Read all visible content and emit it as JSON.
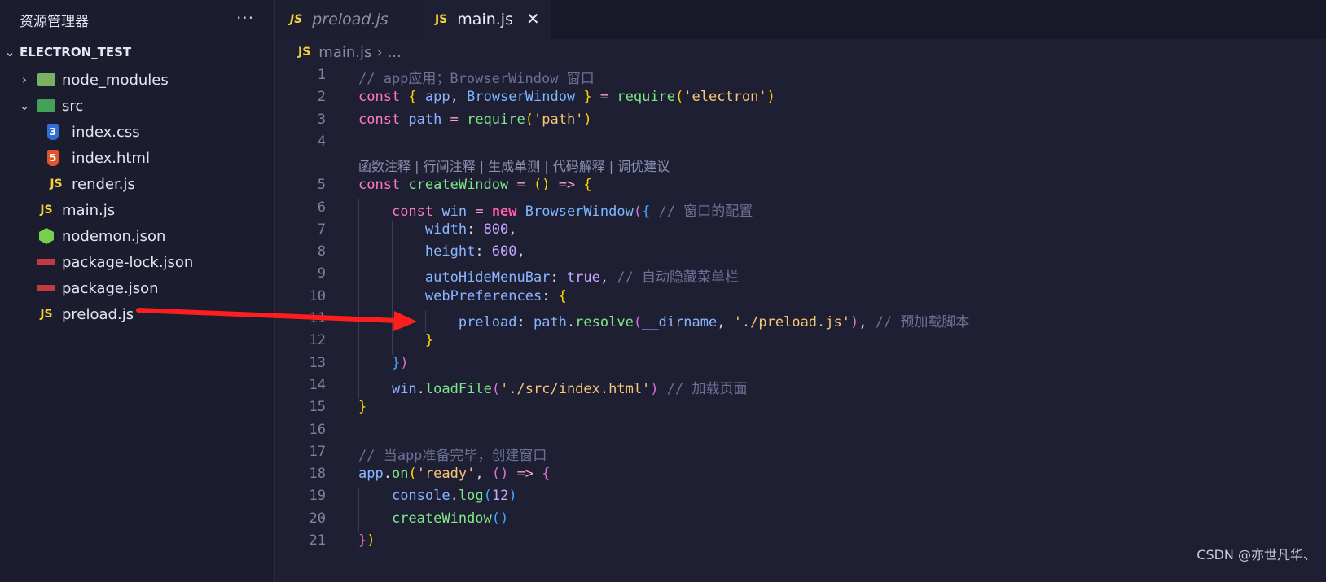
{
  "sidebar": {
    "title": "资源管理器",
    "more": "···",
    "project": "ELECTRON_TEST",
    "items": [
      {
        "label": "node_modules",
        "icon": "folder-icon",
        "chevron": "›"
      },
      {
        "label": "src",
        "icon": "folder-src-icon",
        "chevron": "⌄"
      },
      {
        "label": "index.css",
        "icon": "css-icon",
        "icon_text": "3"
      },
      {
        "label": "index.html",
        "icon": "html-icon",
        "icon_text": "5"
      },
      {
        "label": "render.js",
        "icon": "js-icon",
        "icon_text": "JS"
      },
      {
        "label": "main.js",
        "icon": "js-icon",
        "icon_text": "JS"
      },
      {
        "label": "nodemon.json",
        "icon": "nodemon-icon"
      },
      {
        "label": "package-lock.json",
        "icon": "npm-icon"
      },
      {
        "label": "package.json",
        "icon": "npm-icon"
      },
      {
        "label": "preload.js",
        "icon": "js-icon",
        "icon_text": "JS"
      }
    ]
  },
  "tabs": [
    {
      "label": "preload.js",
      "icon_text": "JS",
      "active": false
    },
    {
      "label": "main.js",
      "icon_text": "JS",
      "active": true,
      "close": "✕"
    }
  ],
  "breadcrumb": {
    "icon_text": "JS",
    "file": "main.js",
    "sep": "›",
    "rest": "..."
  },
  "editor": {
    "code_lens": "函数注释 | 行间注释 | 生成单测 | 代码解释 | 调优建议",
    "lines": [
      {
        "n": "1",
        "tokens": [
          [
            "cm",
            "// app应用；BrowserWindow 窗口"
          ]
        ]
      },
      {
        "n": "2",
        "tokens": [
          [
            "kw",
            "const "
          ],
          [
            "p1",
            "{ "
          ],
          [
            "vr",
            "app"
          ],
          [
            "pl",
            ", "
          ],
          [
            "cls",
            "BrowserWindow"
          ],
          [
            "p1",
            " }"
          ],
          [
            "op",
            " = "
          ],
          [
            "fn",
            "require"
          ],
          [
            "p1",
            "("
          ],
          [
            "st",
            "'electron'"
          ],
          [
            "p1",
            ")"
          ]
        ]
      },
      {
        "n": "3",
        "tokens": [
          [
            "kw",
            "const "
          ],
          [
            "vr",
            "path"
          ],
          [
            "op",
            " = "
          ],
          [
            "fn",
            "require"
          ],
          [
            "p1",
            "("
          ],
          [
            "st",
            "'path'"
          ],
          [
            "p1",
            ")"
          ]
        ]
      },
      {
        "n": "4",
        "tokens": []
      },
      {
        "n": "5",
        "tokens": [
          [
            "kw",
            "const "
          ],
          [
            "fn",
            "createWindow"
          ],
          [
            "op",
            " = "
          ],
          [
            "p1",
            "()"
          ],
          [
            "op",
            " => "
          ],
          [
            "p1",
            "{"
          ]
        ]
      },
      {
        "n": "6",
        "tokens": [
          [
            "pl",
            "    "
          ],
          [
            "kw",
            "const "
          ],
          [
            "vr",
            "win"
          ],
          [
            "op",
            " = "
          ],
          [
            "kw2",
            "new "
          ],
          [
            "cls",
            "BrowserWindow"
          ],
          [
            "p2",
            "("
          ],
          [
            "p3",
            "{"
          ],
          [
            "cm",
            " // 窗口的配置"
          ]
        ]
      },
      {
        "n": "7",
        "tokens": [
          [
            "pl",
            "        "
          ],
          [
            "pr",
            "width"
          ],
          [
            "pl",
            ": "
          ],
          [
            "nm",
            "800"
          ],
          [
            "pl",
            ","
          ]
        ]
      },
      {
        "n": "8",
        "tokens": [
          [
            "pl",
            "        "
          ],
          [
            "pr",
            "height"
          ],
          [
            "pl",
            ": "
          ],
          [
            "nm",
            "600"
          ],
          [
            "pl",
            ","
          ]
        ]
      },
      {
        "n": "9",
        "tokens": [
          [
            "pl",
            "        "
          ],
          [
            "pr",
            "autoHideMenuBar"
          ],
          [
            "pl",
            ": "
          ],
          [
            "nm",
            "true"
          ],
          [
            "pl",
            ", "
          ],
          [
            "cm",
            "// 自动隐藏菜单栏"
          ]
        ]
      },
      {
        "n": "10",
        "tokens": [
          [
            "pl",
            "        "
          ],
          [
            "pr",
            "webPreferences"
          ],
          [
            "pl",
            ": "
          ],
          [
            "p1",
            "{"
          ]
        ]
      },
      {
        "n": "11",
        "tokens": [
          [
            "pl",
            "            "
          ],
          [
            "pr",
            "preload"
          ],
          [
            "pl",
            ": "
          ],
          [
            "vr",
            "path"
          ],
          [
            "pl",
            "."
          ],
          [
            "fn",
            "resolve"
          ],
          [
            "p2",
            "("
          ],
          [
            "vr",
            "__dirname"
          ],
          [
            "pl",
            ", "
          ],
          [
            "st",
            "'./preload.js'"
          ],
          [
            "p2",
            ")"
          ],
          [
            "pl",
            ", "
          ],
          [
            "cm",
            "// 预加载脚本"
          ]
        ]
      },
      {
        "n": "12",
        "tokens": [
          [
            "pl",
            "        "
          ],
          [
            "p1",
            "}"
          ]
        ]
      },
      {
        "n": "13",
        "tokens": [
          [
            "pl",
            "    "
          ],
          [
            "p3",
            "}"
          ],
          [
            "p2",
            ")"
          ]
        ]
      },
      {
        "n": "14",
        "tokens": [
          [
            "pl",
            "    "
          ],
          [
            "vr",
            "win"
          ],
          [
            "pl",
            "."
          ],
          [
            "fn",
            "loadFile"
          ],
          [
            "p2",
            "("
          ],
          [
            "st",
            "'./src/index.html'"
          ],
          [
            "p2",
            ")"
          ],
          [
            "cm",
            " // 加载页面"
          ]
        ]
      },
      {
        "n": "15",
        "tokens": [
          [
            "p1",
            "}"
          ]
        ]
      },
      {
        "n": "16",
        "tokens": []
      },
      {
        "n": "17",
        "tokens": [
          [
            "cm",
            "// 当app准备完毕，创建窗口"
          ]
        ]
      },
      {
        "n": "18",
        "tokens": [
          [
            "vr",
            "app"
          ],
          [
            "pl",
            "."
          ],
          [
            "fn",
            "on"
          ],
          [
            "p1",
            "("
          ],
          [
            "st",
            "'ready'"
          ],
          [
            "pl",
            ", "
          ],
          [
            "p2",
            "()"
          ],
          [
            "op",
            " => "
          ],
          [
            "p2",
            "{"
          ]
        ]
      },
      {
        "n": "19",
        "tokens": [
          [
            "pl",
            "    "
          ],
          [
            "vr",
            "console"
          ],
          [
            "pl",
            "."
          ],
          [
            "fn",
            "log"
          ],
          [
            "p3",
            "("
          ],
          [
            "nm",
            "12"
          ],
          [
            "p3",
            ")"
          ]
        ]
      },
      {
        "n": "20",
        "tokens": [
          [
            "pl",
            "    "
          ],
          [
            "fn",
            "createWindow"
          ],
          [
            "p3",
            "()"
          ]
        ]
      },
      {
        "n": "21",
        "tokens": [
          [
            "p2",
            "}"
          ],
          [
            "p1",
            ")"
          ]
        ]
      }
    ]
  },
  "annotation": {
    "color": "#ff1e1e"
  },
  "watermark": "CSDN @亦世凡华、",
  "colors": {
    "background": "#1e1f33",
    "sidebar": "#1b1c2e",
    "tabbar": "#181928",
    "accent_js": "#f2d23a"
  }
}
